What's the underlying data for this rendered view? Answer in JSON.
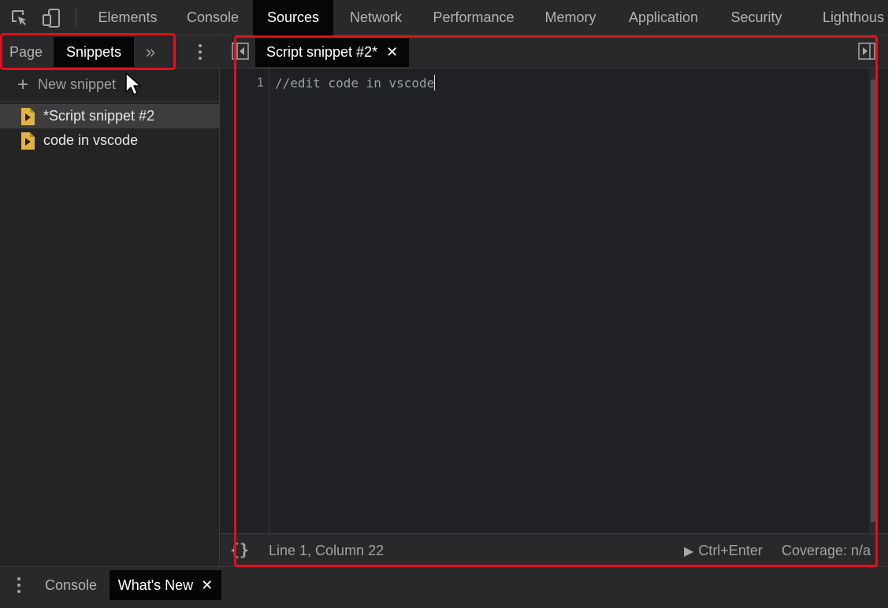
{
  "toolbar": {
    "tabs": [
      {
        "label": "Elements"
      },
      {
        "label": "Console"
      },
      {
        "label": "Sources"
      },
      {
        "label": "Network"
      },
      {
        "label": "Performance"
      },
      {
        "label": "Memory"
      },
      {
        "label": "Application"
      },
      {
        "label": "Security"
      },
      {
        "label": "Lighthous"
      }
    ],
    "active_tab": "Sources"
  },
  "navigator": {
    "tabs": [
      {
        "label": "Page"
      },
      {
        "label": "Snippets"
      }
    ],
    "more_glyph": "»",
    "new_snippet_label": "New snippet",
    "files": [
      {
        "label": "*Script snippet #2",
        "selected": true,
        "icon": "snippet-file-icon"
      },
      {
        "label": "code in vscode",
        "selected": false,
        "icon": "snippet-file-icon"
      }
    ]
  },
  "editor": {
    "tab_label": "Script snippet #2*",
    "close_glyph": "✕",
    "line_number": "1",
    "code_line": "//edit code in vscode",
    "status": {
      "format_glyph": "{}",
      "position": "Line 1, Column 22",
      "run_label": "Ctrl+Enter",
      "coverage": "Coverage: n/a"
    }
  },
  "drawer": {
    "tabs": [
      {
        "label": "Console"
      },
      {
        "label": "What's New"
      }
    ],
    "close_glyph": "✕"
  },
  "colors": {
    "accent_highlight": "#e0101b",
    "snippet_icon": "#e3b341",
    "background": "#242424",
    "active_tab": "#060606"
  }
}
